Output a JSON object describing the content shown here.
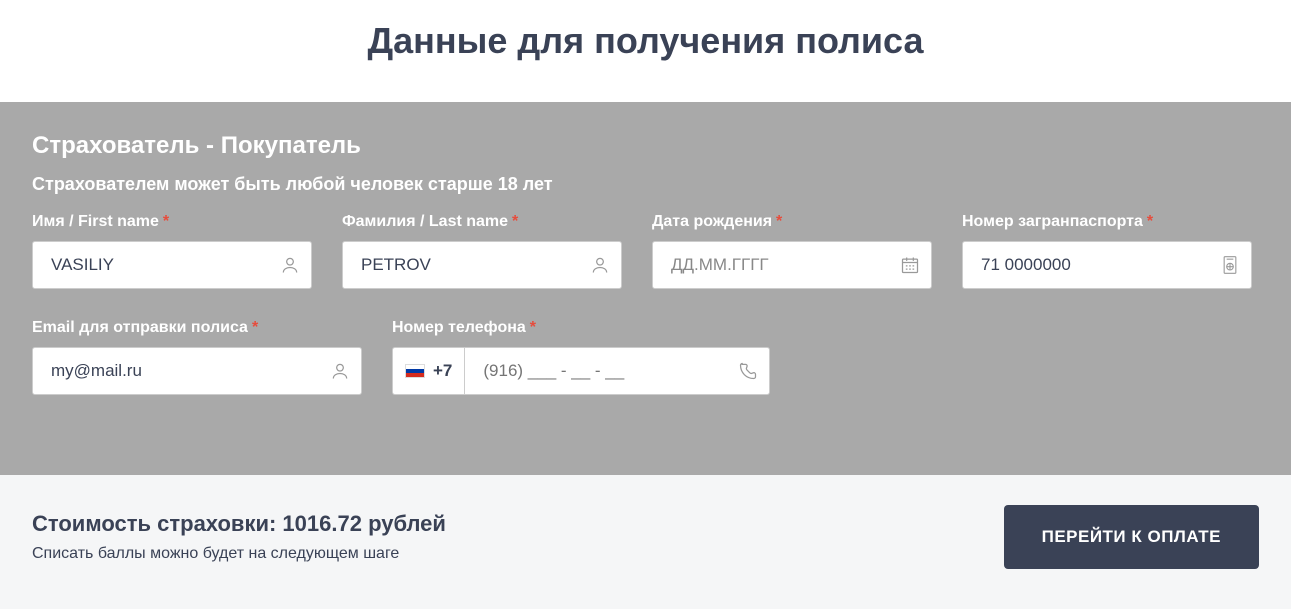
{
  "page": {
    "title": "Данные для получения полиса"
  },
  "insurant": {
    "section_title": "Страхователь - Покупатель",
    "section_subtitle": "Страхователем может быть любой человек старше 18 лет",
    "fields": {
      "first_name": {
        "label": "Имя / First name",
        "value": "VASILIY"
      },
      "last_name": {
        "label": "Фамилия / Last name",
        "value": "PETROV"
      },
      "birth_date": {
        "label": "Дата рождения",
        "placeholder": "ДД.ММ.ГГГГ",
        "value": ""
      },
      "passport": {
        "label": "Номер загранпаспорта",
        "value": "71 0000000"
      },
      "email": {
        "label": "Email для отправки полиса",
        "value": "my@mail.ru"
      },
      "phone": {
        "label": "Номер телефона",
        "code": "+7",
        "placeholder": "(916) ___ - __ - __",
        "value": ""
      }
    }
  },
  "footer": {
    "cost_prefix": "Стоимость страховки: ",
    "cost_value": "1016.72",
    "cost_suffix": " рублей",
    "points_note": "Списать баллы можно будет на следующем шаге",
    "pay_button": "ПЕРЕЙТИ К ОПЛАТЕ"
  },
  "required_mark": "*"
}
